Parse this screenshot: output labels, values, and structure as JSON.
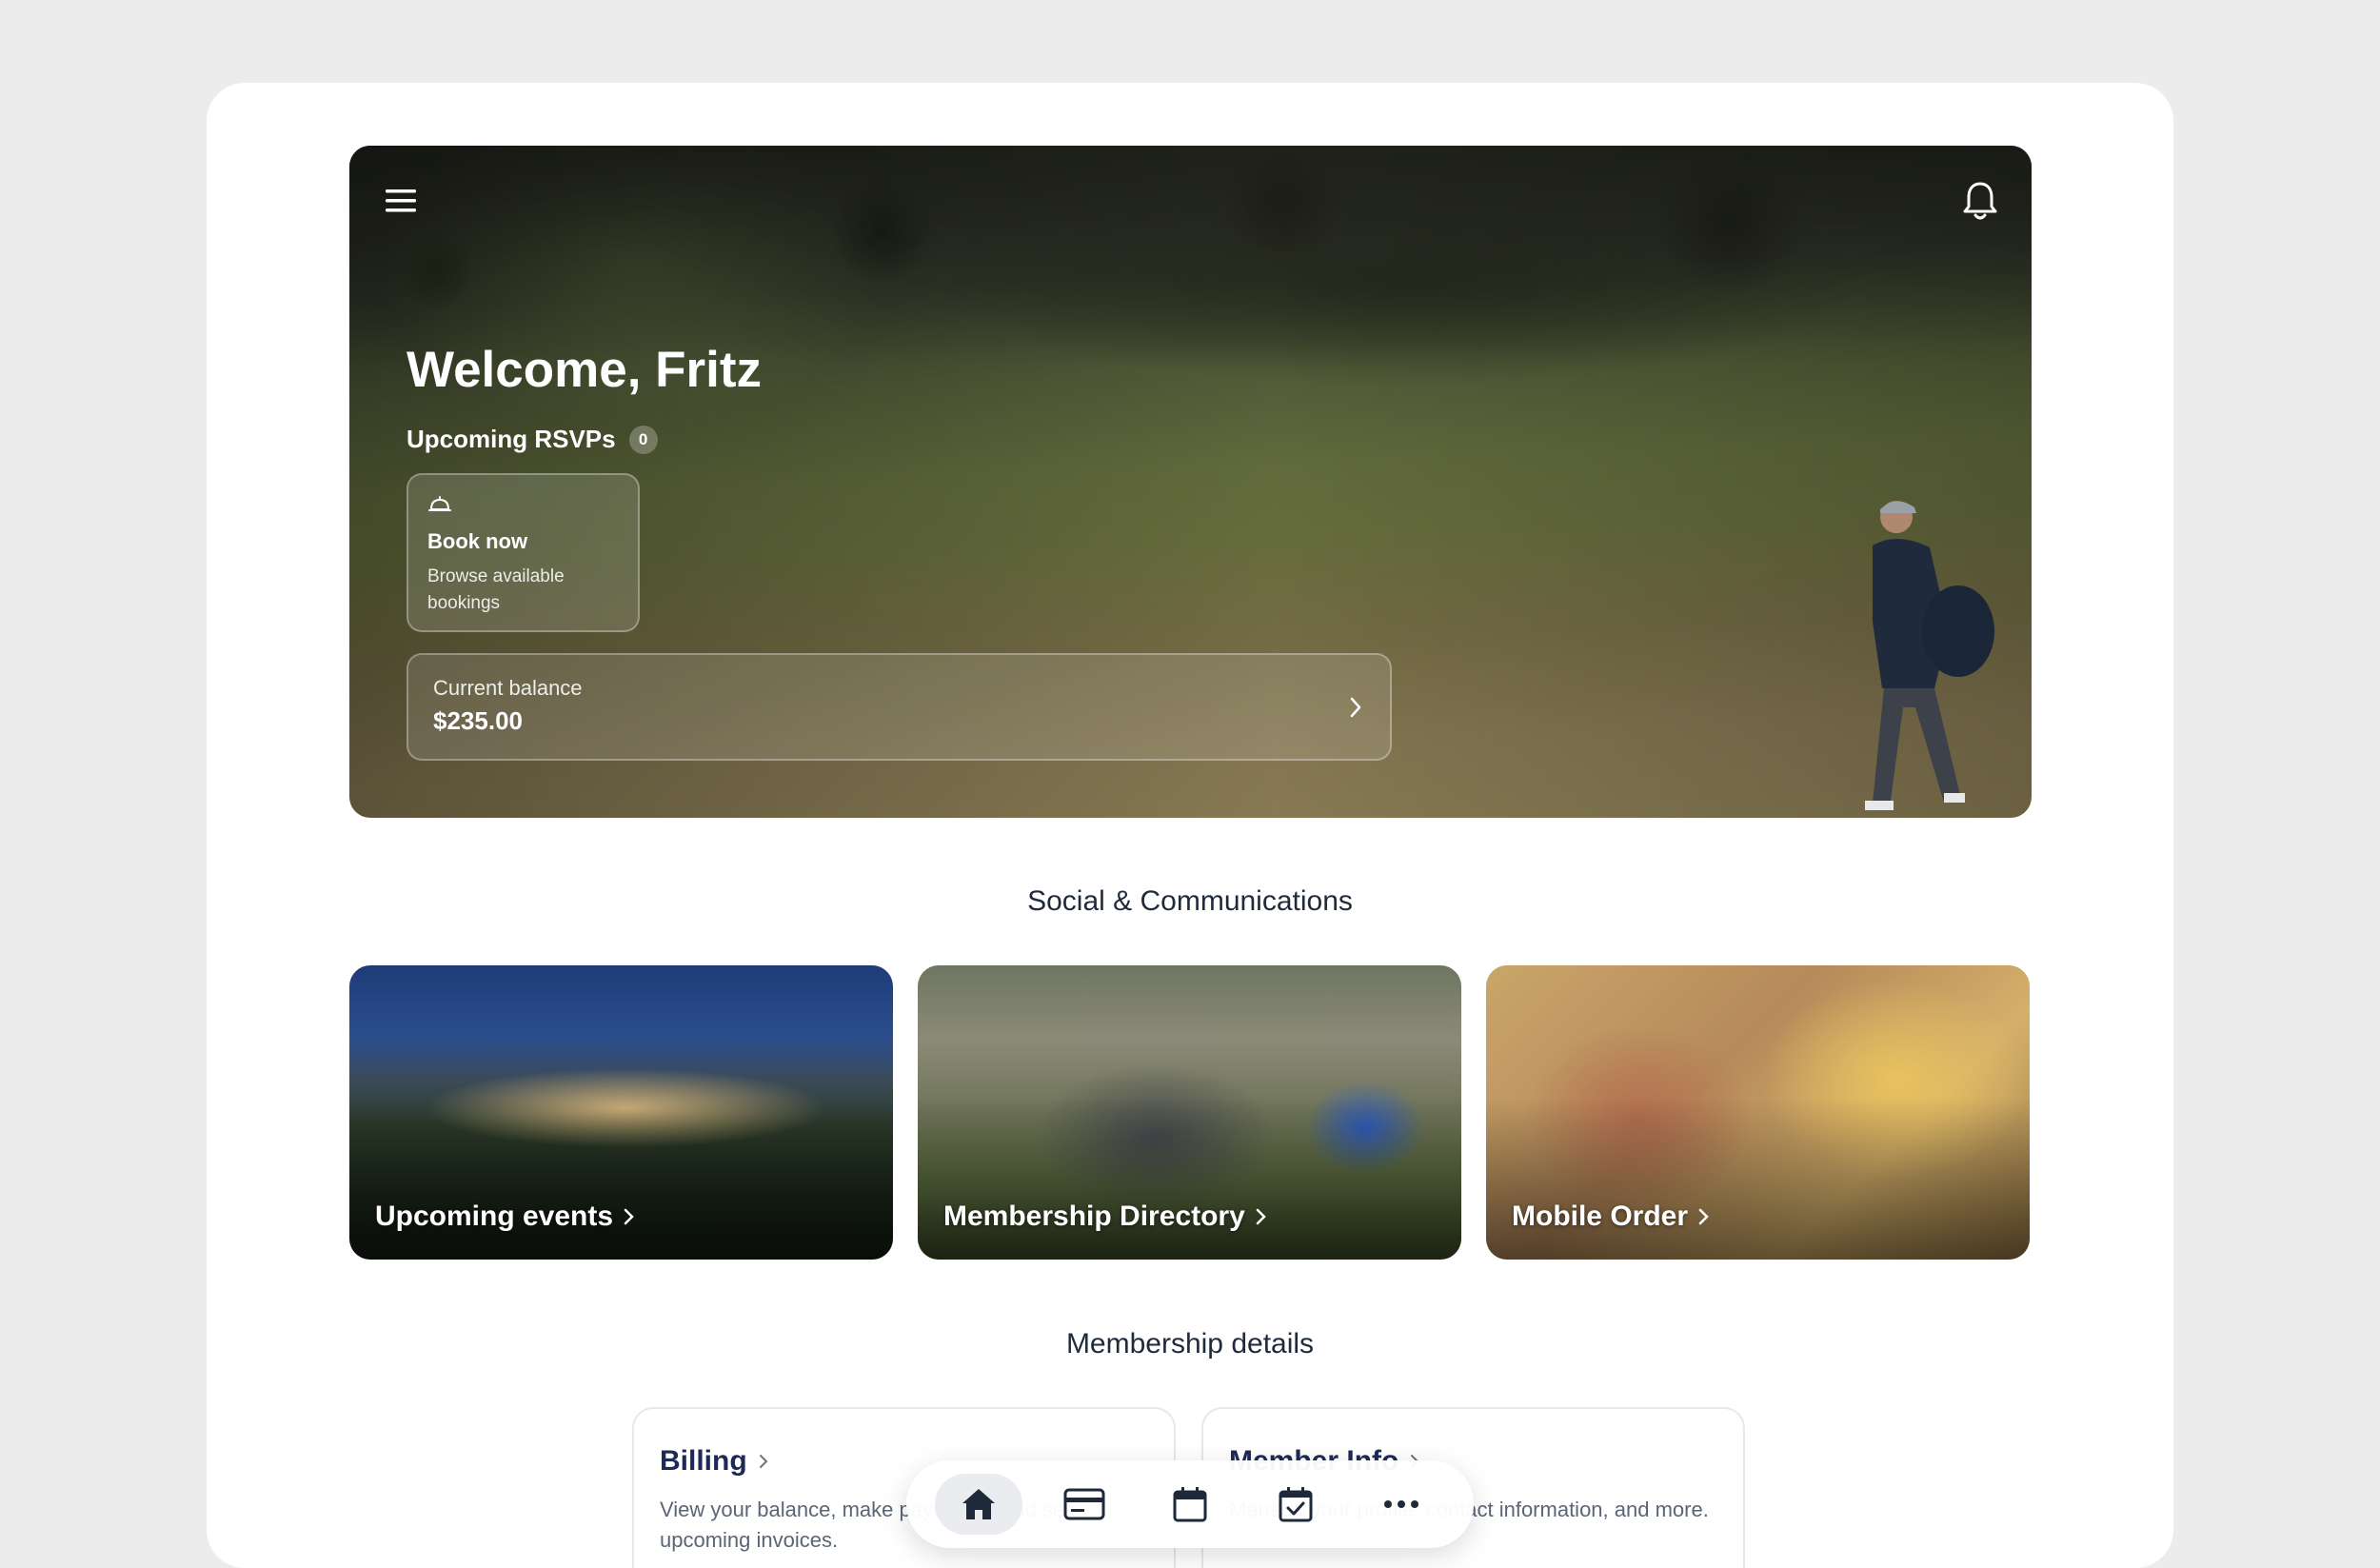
{
  "hero": {
    "welcome": "Welcome, Fritz",
    "rsvp_label": "Upcoming RSVPs",
    "rsvp_count": "0",
    "book_title": "Book now",
    "book_subtitle": "Browse available bookings",
    "balance_label": "Current balance",
    "balance_value": "$235.00",
    "menu_icon": "hamburger-menu-icon",
    "notification_icon": "bell-icon"
  },
  "social": {
    "title": "Social & Communications",
    "tiles": [
      {
        "label": "Upcoming events"
      },
      {
        "label": "Membership Directory"
      },
      {
        "label": "Mobile Order"
      }
    ]
  },
  "membership": {
    "title": "Membership details",
    "cards": [
      {
        "title": "Billing",
        "description": "View your balance, make payments, and see upcoming invoices."
      },
      {
        "title": "Member Info",
        "description": "Manage your profile, contact information, and more."
      }
    ]
  },
  "bottom_nav": {
    "items": [
      {
        "icon": "home-icon",
        "active": true
      },
      {
        "icon": "credit-card-icon",
        "active": false
      },
      {
        "icon": "calendar-icon",
        "active": false
      },
      {
        "icon": "calendar-check-icon",
        "active": false
      },
      {
        "icon": "more-horizontal-icon",
        "active": false
      }
    ]
  },
  "colors": {
    "background": "#ececec",
    "surface": "#ffffff",
    "heading_navy": "#1e2a55",
    "text_muted": "#5b6575"
  }
}
